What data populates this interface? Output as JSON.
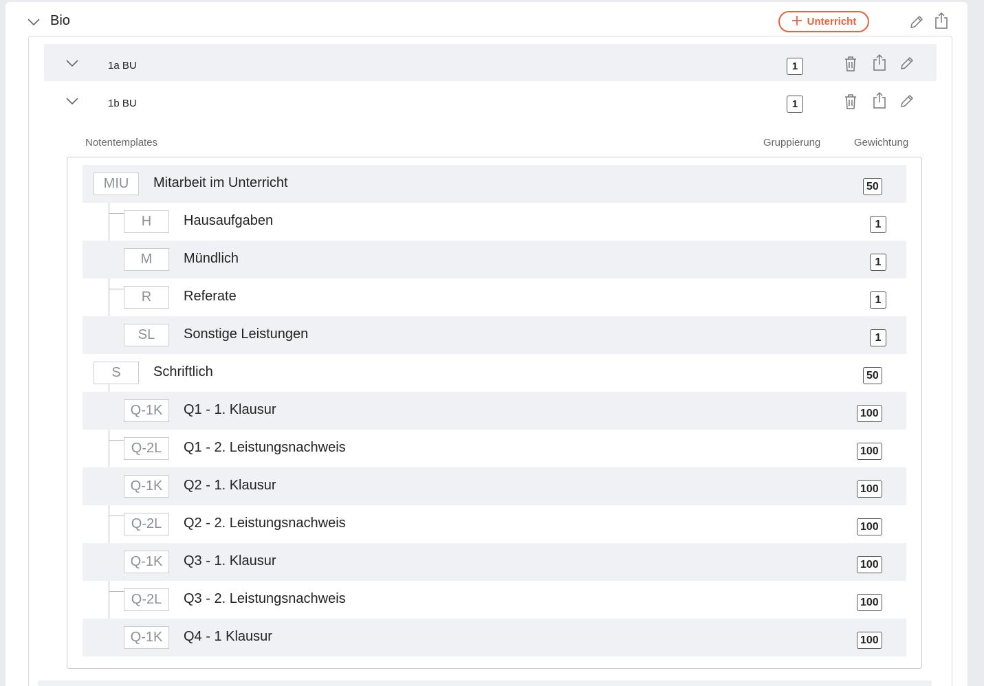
{
  "subject": {
    "title": "Bio",
    "add_button_label": "Unterricht",
    "icons": {
      "edit": "pencil-icon",
      "export": "export-icon",
      "collapse": "chevron-down-icon",
      "add": "plus-icon",
      "delete": "trash-icon"
    }
  },
  "classes": [
    {
      "name": "1a BU",
      "count": "1"
    },
    {
      "name": "1b BU",
      "count": "1"
    }
  ],
  "templates": {
    "header": {
      "title": "Notentemplates",
      "grouping": "Gruppierung",
      "weighting": "Gewichtung"
    },
    "groups": [
      {
        "code": "MIU",
        "name": "Mitarbeit im Unterricht",
        "weight": "50",
        "children": [
          {
            "code": "H",
            "name": "Hausaufgaben",
            "weight": "1"
          },
          {
            "code": "M",
            "name": "Mündlich",
            "weight": "1"
          },
          {
            "code": "R",
            "name": "Referate",
            "weight": "1"
          },
          {
            "code": "SL",
            "name": "Sonstige Leistungen",
            "weight": "1"
          }
        ]
      },
      {
        "code": "S",
        "name": "Schriftlich",
        "weight": "50",
        "children": [
          {
            "code": "Q-1K",
            "name": "Q1 - 1. Klausur",
            "weight": "100"
          },
          {
            "code": "Q-2L",
            "name": "Q1 - 2. Leistungsnachweis",
            "weight": "100"
          },
          {
            "code": "Q-1K",
            "name": "Q2 - 1. Klausur",
            "weight": "100"
          },
          {
            "code": "Q-2L",
            "name": "Q2 - 2. Leistungsnachweis",
            "weight": "100"
          },
          {
            "code": "Q-1K",
            "name": "Q3 - 1. Klausur",
            "weight": "100"
          },
          {
            "code": "Q-2L",
            "name": "Q3 - 2. Leistungsnachweis",
            "weight": "100"
          },
          {
            "code": "Q-1K",
            "name": "Q4 - 1 Klausur",
            "weight": "100"
          }
        ]
      }
    ]
  },
  "colors": {
    "accent": "#e8623c",
    "row_shade": "#eff1f4",
    "code_text": "#8b9097"
  }
}
